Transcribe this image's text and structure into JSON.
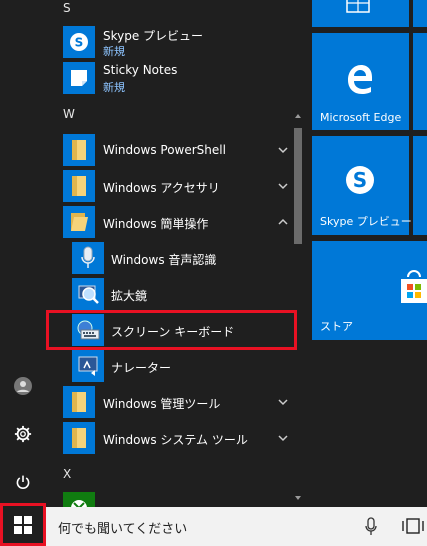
{
  "app_list": {
    "sections": [
      {
        "letter": "S"
      },
      {
        "letter": "W"
      },
      {
        "letter": "X"
      }
    ],
    "items": [
      {
        "name": "Skype プレビュー",
        "badge": "新規"
      },
      {
        "name": "Sticky Notes",
        "badge": "新規"
      },
      {
        "name": "Windows PowerShell"
      },
      {
        "name": "Windows アクセサリ"
      },
      {
        "name": "Windows 簡単操作"
      },
      {
        "name": "Windows 音声認識"
      },
      {
        "name": "拡大鏡"
      },
      {
        "name": "スクリーン キーボード"
      },
      {
        "name": "ナレーター"
      },
      {
        "name": "Windows 管理ツール"
      },
      {
        "name": "Windows システム ツール"
      }
    ]
  },
  "tiles": [
    {
      "label": ""
    },
    {
      "label": "Microsoft Edge"
    },
    {
      "label": "Skype プレビュー"
    },
    {
      "label": "ストア"
    }
  ],
  "taskbar": {
    "search_placeholder": "何でも聞いてください"
  },
  "colors": {
    "accent": "#0078d7",
    "highlight_border": "#e81123",
    "badge_text": "#8dc4ff"
  }
}
